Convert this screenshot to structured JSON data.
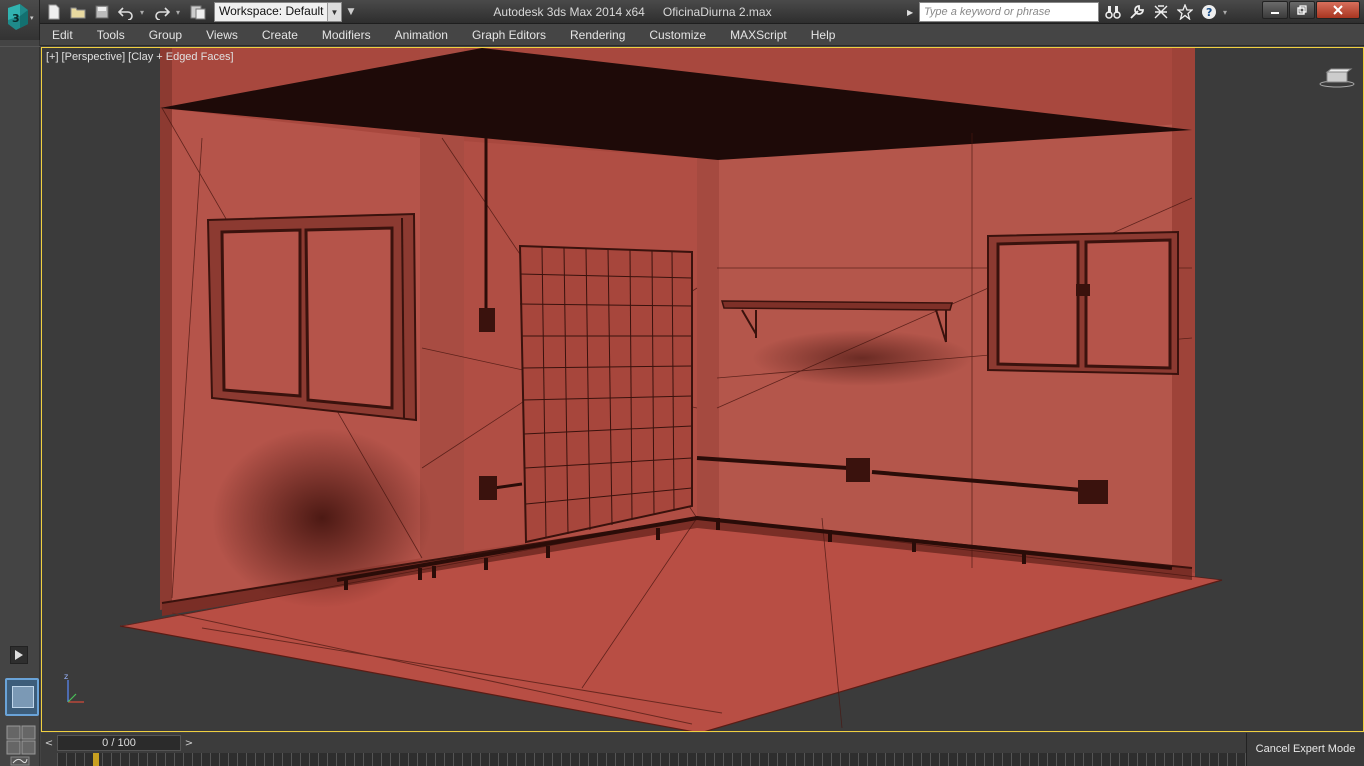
{
  "title_bar": {
    "app_name": "Autodesk 3ds Max  2014 x64",
    "file_name": "OficinaDiurna 2.max",
    "workspace_label": "Workspace: Default",
    "search_placeholder": "Type a keyword or phrase",
    "quick_access_icons": [
      "new-file-icon",
      "open-folder-icon",
      "save-icon",
      "undo-icon",
      "redo-icon",
      "project-folder-icon"
    ],
    "info_icons": [
      "binoculars-icon",
      "wrench-icon",
      "communication-icon",
      "star-icon",
      "help-icon"
    ]
  },
  "menu": {
    "items": [
      "Edit",
      "Tools",
      "Group",
      "Views",
      "Create",
      "Modifiers",
      "Animation",
      "Graph Editors",
      "Rendering",
      "Customize",
      "MAXScript",
      "Help"
    ]
  },
  "viewport": {
    "label": {
      "plus": "[+]",
      "view": "[Perspective]",
      "shading": "[Clay + Edged Faces]"
    },
    "border_color": "#f0d040",
    "wall_color": "#b5544a",
    "floor_color": "#b84e44",
    "ceiling_color": "#1e0a08",
    "axis_label": "z"
  },
  "timeline": {
    "frame_display": "0 / 100",
    "prev_glyph": "<",
    "next_glyph": ">",
    "cancel_label": "Cancel Expert Mode"
  }
}
